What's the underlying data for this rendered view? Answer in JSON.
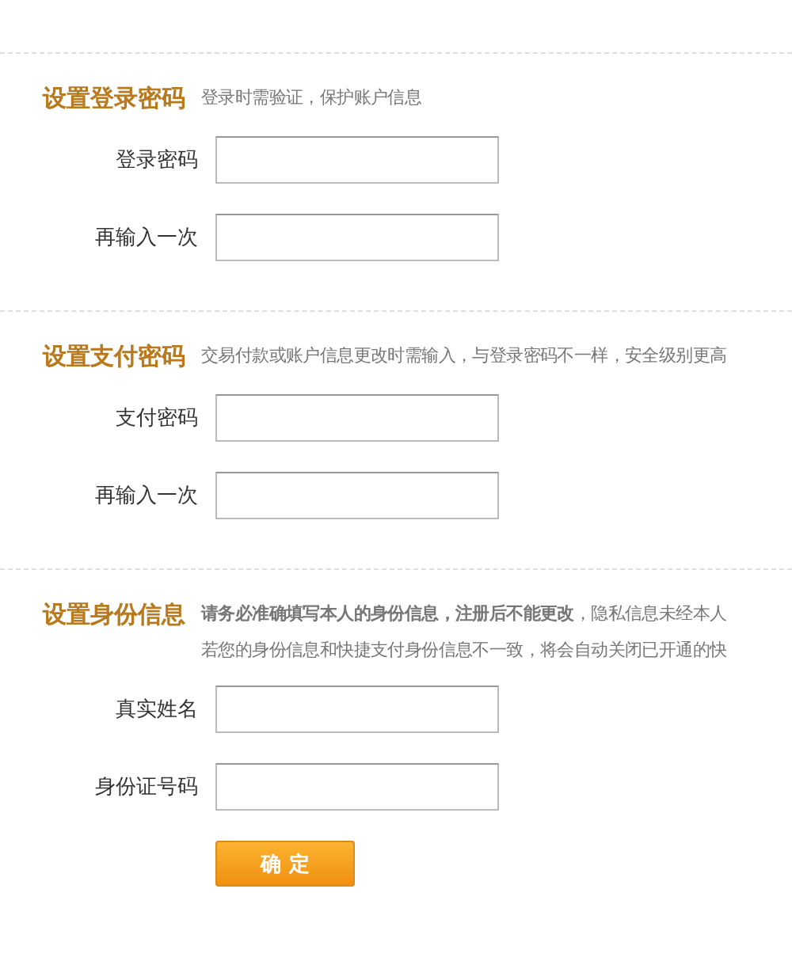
{
  "sections": [
    {
      "title": "设置登录密码",
      "notes": [
        "登录时需验证，保护账户信息"
      ],
      "fields": [
        {
          "label": "登录密码"
        },
        {
          "label": "再输入一次"
        }
      ]
    },
    {
      "title": "设置支付密码",
      "notes": [
        "交易付款或账户信息更改时需输入，与登录密码不一样，安全级别更高"
      ],
      "fields": [
        {
          "label": "支付密码"
        },
        {
          "label": "再输入一次"
        }
      ]
    },
    {
      "title": "设置身份信息",
      "notes": [
        "**请务必准确填写本人的身份信息，注册后不能更改**，隐私信息未经本人",
        "若您的身份信息和快捷支付身份信息不一致，将会自动关闭已开通的快"
      ],
      "fields": [
        {
          "label": "真实姓名"
        },
        {
          "label": "身份证号码"
        }
      ]
    }
  ],
  "submit": "确 定"
}
